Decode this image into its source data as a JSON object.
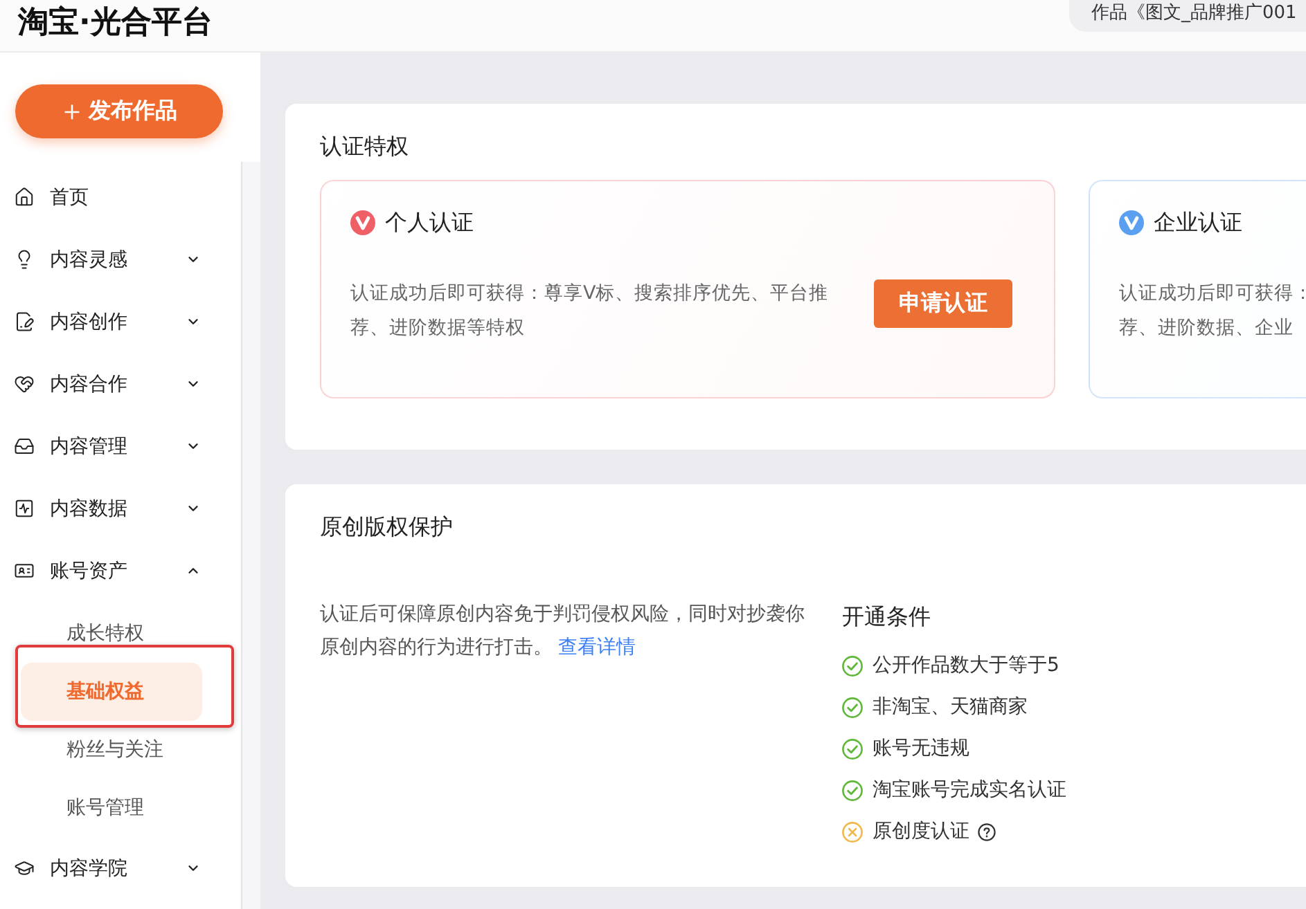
{
  "header": {
    "logo": "淘宝·光合平台",
    "work_title": "作品《图文_品牌推广001"
  },
  "sidebar": {
    "publish_button": "发布作品",
    "items": [
      {
        "label": "首页",
        "selected": false
      },
      {
        "label": "内容灵感",
        "selected": false,
        "expanded": false
      },
      {
        "label": "内容创作",
        "selected": false,
        "expanded": false
      },
      {
        "label": "内容合作",
        "selected": false,
        "expanded": false
      },
      {
        "label": "内容管理",
        "selected": false,
        "expanded": false
      },
      {
        "label": "内容数据",
        "selected": false,
        "expanded": false
      },
      {
        "label": "账号资产",
        "selected": false,
        "expanded": true,
        "children": [
          {
            "label": "成长特权",
            "selected": false,
            "highlighted": false
          },
          {
            "label": "基础权益",
            "selected": true,
            "highlighted": true
          },
          {
            "label": "粉丝与关注",
            "selected": false,
            "highlighted": false
          },
          {
            "label": "账号管理",
            "selected": false,
            "highlighted": false
          }
        ]
      },
      {
        "label": "内容学院",
        "selected": false,
        "expanded": false
      }
    ]
  },
  "certification": {
    "title": "认证特权",
    "cards": [
      {
        "title": "个人认证",
        "color": "#ef5f66",
        "description_lines": [
          "认证成功后即可获得：尊享V标、搜索排序优先、平台推",
          "荐、进阶数据等特权"
        ],
        "button": "申请认证"
      },
      {
        "title": "企业认证",
        "color": "#5b9ff0",
        "description_lines": [
          "认证成功后即可获得：",
          "荐、进阶数据、企业"
        ]
      }
    ]
  },
  "copyright": {
    "title": "原创版权保护",
    "description": "认证后可保障原创内容免于判罚侵权风险，同时对抄袭你原创内容的行为进行打击。",
    "link": "查看详情",
    "conditions": {
      "title": "开通条件",
      "items": [
        {
          "label": "公开作品数大于等于5",
          "met": true
        },
        {
          "label": "非淘宝、天猫商家",
          "met": true
        },
        {
          "label": "账号无违规",
          "met": true
        },
        {
          "label": "淘宝账号完成实名认证",
          "met": true
        },
        {
          "label": "原创度认证",
          "met": false,
          "help": true
        }
      ]
    }
  }
}
